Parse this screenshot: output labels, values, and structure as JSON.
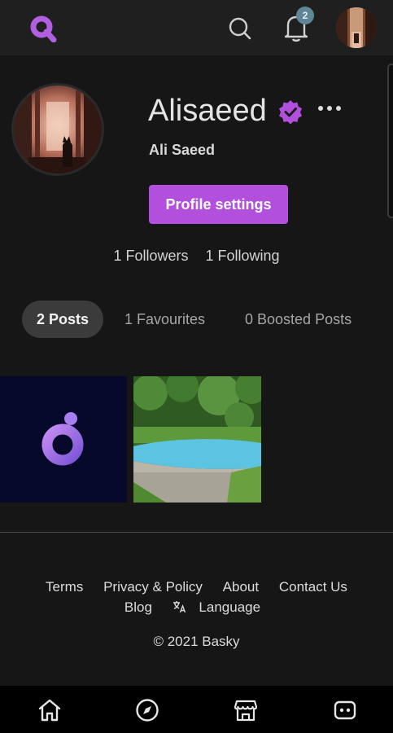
{
  "topbar": {
    "logo_icon": "basky-logo-icon",
    "search_icon": "search-icon",
    "notifications": {
      "icon": "bell-icon",
      "badge": "2"
    },
    "avatar_icon": "user-avatar"
  },
  "profile": {
    "username": "Alisaeed",
    "verified_icon": "verified-badge-icon",
    "full_name": "Ali Saeed",
    "settings_label": "Profile settings",
    "followers": "1 Followers",
    "following": "1 Following"
  },
  "tabs": [
    {
      "label": "2 Posts",
      "active": true
    },
    {
      "label": "1 Favourites",
      "active": false
    },
    {
      "label": "0 Boosted Posts",
      "active": false
    }
  ],
  "posts": [
    {
      "name": "post-logo-image"
    },
    {
      "name": "post-pool-image"
    }
  ],
  "footer": {
    "links_row1": [
      "Terms",
      "Privacy & Policy",
      "About",
      "Contact Us"
    ],
    "links_row2": [
      "Blog",
      "Language"
    ],
    "copyright": "© 2021 Basky"
  },
  "bottom_nav": [
    {
      "icon": "home-icon"
    },
    {
      "icon": "compass-icon"
    },
    {
      "icon": "store-icon"
    },
    {
      "icon": "chat-icon"
    }
  ],
  "colors": {
    "accent": "#b24fdc",
    "background": "#161616",
    "topbar": "#1f1f1f",
    "badge": "#5f8696"
  }
}
